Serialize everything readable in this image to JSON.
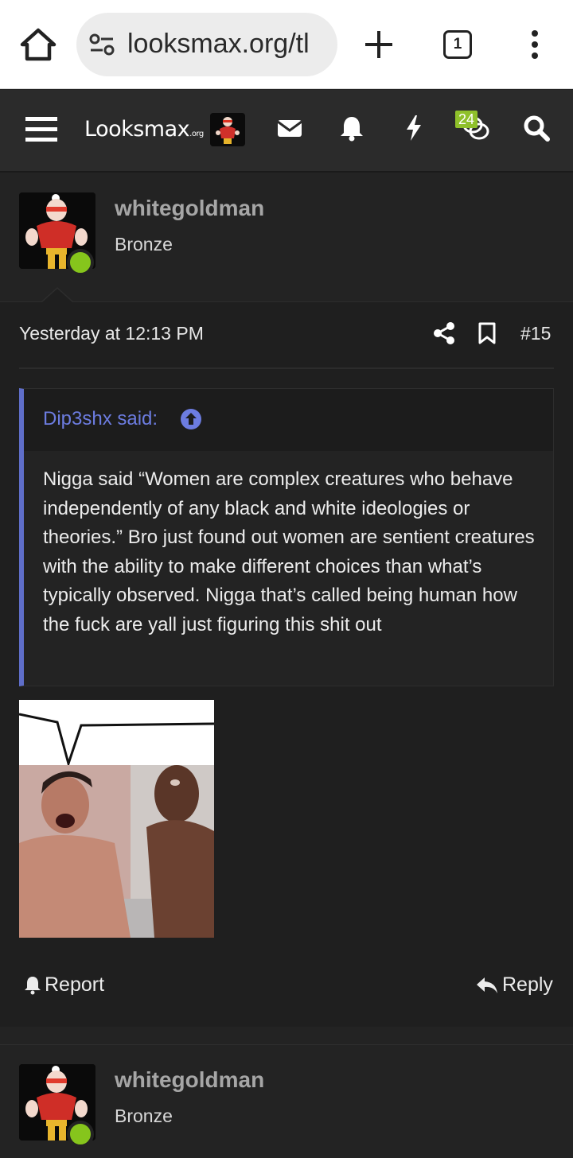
{
  "browser": {
    "url": "looksmax.org/tl",
    "tab_count": "1"
  },
  "site": {
    "logo_main": "Looksmax",
    "logo_tld": ".org",
    "conversations_badge": "24"
  },
  "post": {
    "author": "whitegoldman",
    "author_title": "Bronze",
    "time": "Yesterday at 12:13 PM",
    "number": "#15",
    "quote": {
      "attribution": "Dip3shx said:",
      "text": "Nigga said “Women are complex creatures who behave independently of any black and white ideologies or theories.” Bro just found out women are sentient creatures with the ability to make different choices than what’s typically observed. Nigga that’s called being human how the fuck are yall just figuring this shit out"
    },
    "report_label": "Report",
    "reply_label": "Reply"
  },
  "next_post": {
    "author": "whitegoldman",
    "author_title": "Bronze"
  },
  "colors": {
    "accent_quote": "#5f6ec9",
    "online": "#86c51c",
    "badge": "#8fc02a"
  }
}
